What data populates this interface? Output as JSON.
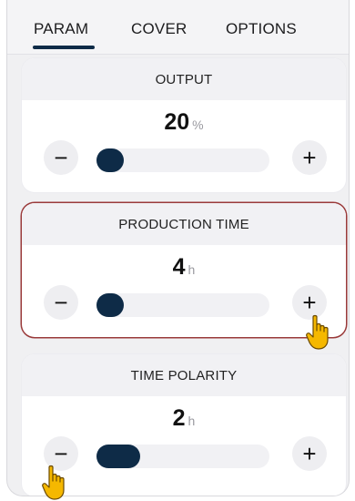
{
  "tabs": [
    {
      "label": "PARAM",
      "active": true
    },
    {
      "label": "COVER",
      "active": false
    },
    {
      "label": "OPTIONS",
      "active": false
    }
  ],
  "cards": [
    {
      "title": "OUTPUT",
      "value": "20",
      "unit": "%",
      "slider_fraction": 0.1,
      "highlighted": false
    },
    {
      "title": "PRODUCTION TIME",
      "value": "4",
      "unit": "h",
      "slider_fraction": 0.08,
      "highlighted": true
    },
    {
      "title": "TIME POLARITY",
      "value": "2",
      "unit": "h",
      "slider_fraction": 0.25,
      "highlighted": false
    }
  ],
  "controls": {
    "minus_symbol": "−",
    "plus_symbol": "+"
  },
  "colors": {
    "accent": "#0e2b47",
    "highlight_border": "#9a3a3a",
    "pointer": "#f5b800"
  },
  "icons": [
    "minus-icon",
    "plus-icon",
    "hand-pointer-icon"
  ]
}
